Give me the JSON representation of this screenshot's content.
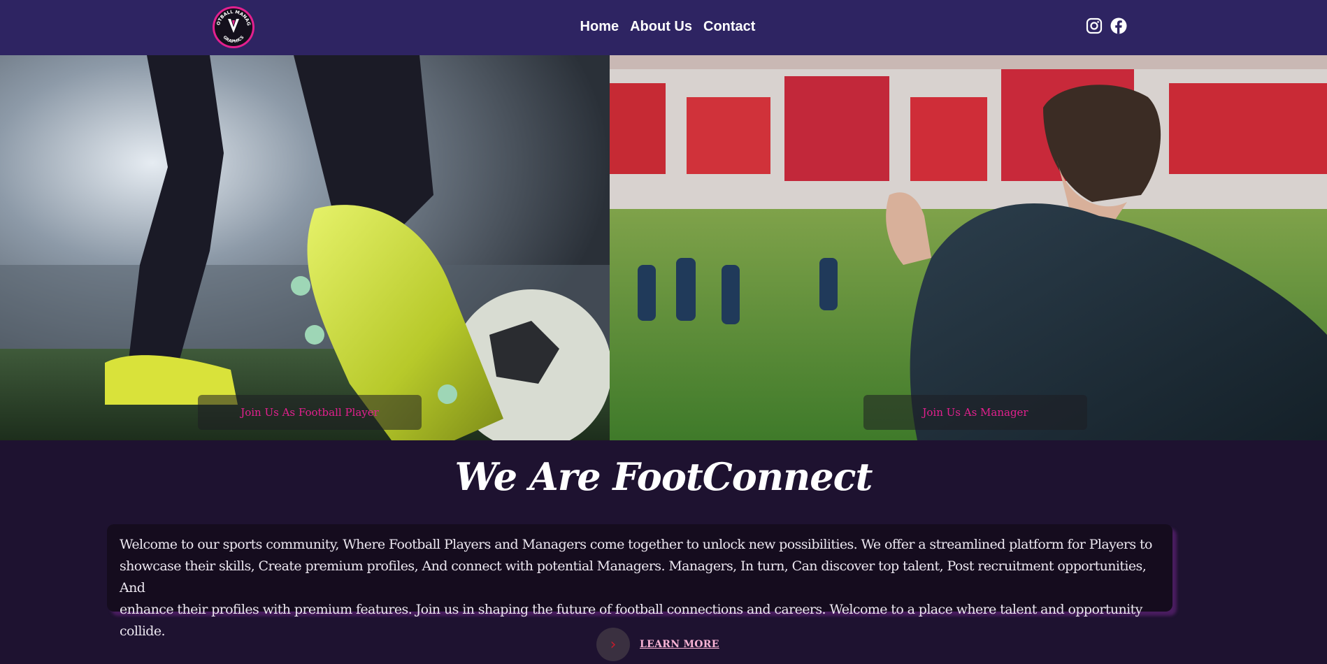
{
  "brand": {
    "logo_icon": "football-manager-graphics-logo",
    "logo_text_top": "FOOTBALL MANAGER",
    "logo_text_bottom": "GRAPHICS",
    "accent_color": "#e3208e",
    "nav_bg_color": "#2e2462",
    "page_bg_color": "#1e1230"
  },
  "nav": {
    "links": [
      {
        "label": "Home"
      },
      {
        "label": "About Us"
      },
      {
        "label": "Contact"
      }
    ],
    "social_icons": [
      "instagram-icon",
      "facebook-icon"
    ]
  },
  "hero": {
    "player_button": "Join Us As Football Player",
    "manager_button": "Join Us As Manager"
  },
  "about": {
    "title": "We Are FootConnect",
    "lines": [
      "Welcome to our sports community, Where Football Players and Managers come together to unlock new possibilities. We offer a streamlined platform for Players to",
      "showcase their skills, Create premium profiles, And connect with potential Managers. Managers, In turn, Can discover top talent, Post recruitment opportunities, And",
      "enhance their profiles with premium features. Join us in shaping the future of football connections and careers. Welcome to a place where talent and opportunity collide."
    ],
    "learn_more": "LEARN MORE",
    "learn_more_icon": "chevron-right-icon"
  }
}
